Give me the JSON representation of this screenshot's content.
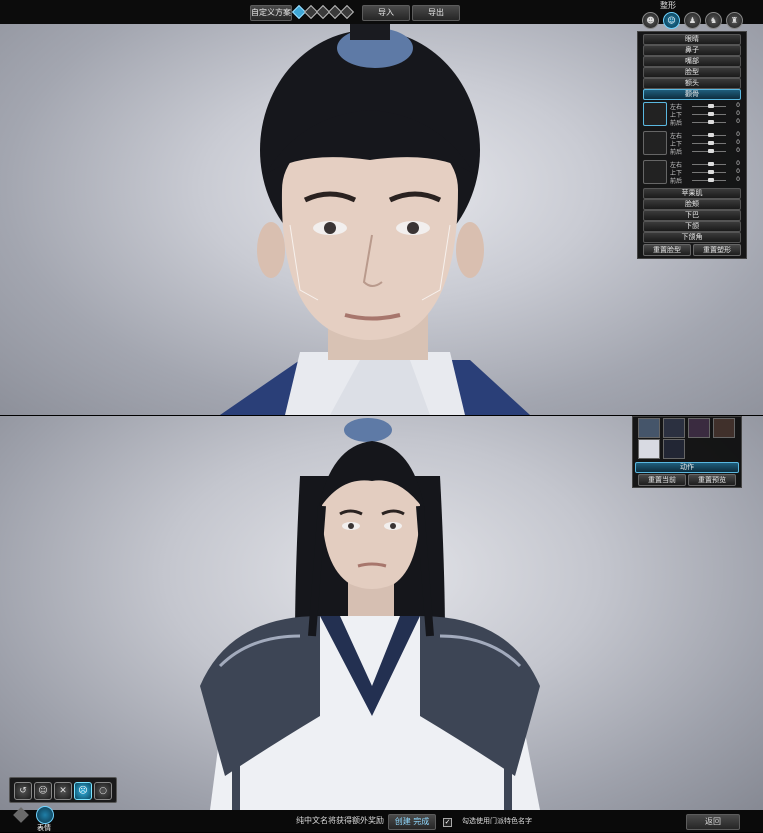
{
  "topbar": {
    "preset_label": "自定义方案",
    "preset_icons": [
      "preset-1-icon",
      "preset-2-icon",
      "preset-3-icon",
      "preset-4-icon",
      "preset-5-icon"
    ],
    "import_label": "导入",
    "export_label": "导出"
  },
  "category": {
    "label": "整形",
    "icons": [
      "head-icon",
      "face-icon",
      "body-icon",
      "hair-icon",
      "costume-icon"
    ],
    "active_index": 1
  },
  "face_panel": {
    "sections": [
      "眼睛",
      "鼻子",
      "嘴部",
      "脸型",
      "额头"
    ],
    "selected": "颧骨",
    "slider_groups": [
      {
        "icon": "axis-icon",
        "sliders": [
          {
            "label": "左右",
            "value": "0"
          },
          {
            "label": "上下",
            "value": "0"
          },
          {
            "label": "前后",
            "value": "0"
          }
        ]
      },
      {
        "icon": "bone-icon",
        "sliders": [
          {
            "label": "左右",
            "value": "0"
          },
          {
            "label": "上下",
            "value": "0"
          },
          {
            "label": "前后",
            "value": "0"
          }
        ]
      },
      {
        "icon": "scale-icon",
        "sliders": [
          {
            "label": "左右",
            "value": "0"
          },
          {
            "label": "上下",
            "value": "0"
          },
          {
            "label": "前后",
            "value": "0"
          }
        ]
      }
    ],
    "sections_after": [
      "苹果肌",
      "脸颊",
      "下巴",
      "下颌",
      "下颌角"
    ],
    "reset_face_label": "重置脸型",
    "reset_shape_label": "重置塑形"
  },
  "preview_panel": {
    "action_label": "动作",
    "reset_current_label": "重置当前",
    "reset_preview_label": "重置预览"
  },
  "expression": {
    "label": "表情",
    "buttons": [
      "rotate-icon",
      "smile-icon",
      "angry-icon",
      "sad-icon",
      "surprise-icon"
    ],
    "active_index": 3
  },
  "bottombar": {
    "notice": "纯中文名将获得额外奖励",
    "create_label": "创建 完成",
    "checkbox_label": "勾选使用门派特色名字",
    "back_label": "返回"
  },
  "colors": {
    "accent": "#3fa7d6",
    "panel_bg": "#0a0a0a"
  }
}
